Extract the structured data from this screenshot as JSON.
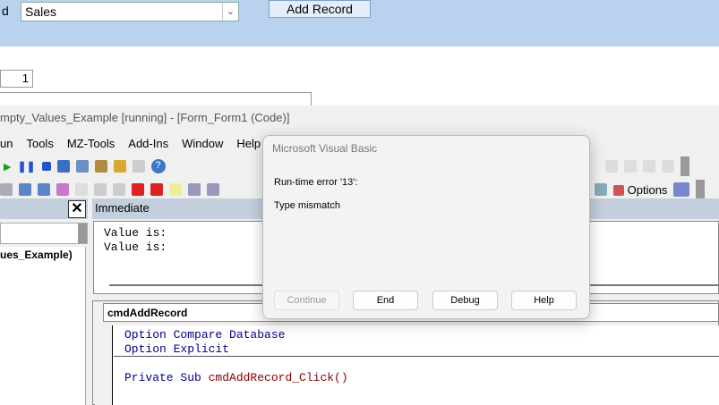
{
  "form": {
    "label_fragment": "d",
    "combo_value": "Sales",
    "add_button": "Add Record",
    "number_value": "1"
  },
  "vbe": {
    "title": "mpty_Values_Example [running] - [Form_Form1 (Code)]",
    "menu": [
      "un",
      "Tools",
      "MZ-Tools",
      "Add-Ins",
      "Window",
      "Help"
    ],
    "toolbar_options": "Options",
    "project_item": "ues_Example)",
    "immediate_title": "Immediate",
    "immediate_lines": [
      "Value is:",
      "Value is:"
    ],
    "object_combo": "cmdAddRecord",
    "code": {
      "l1a": "Option Compare Database",
      "l2a": "Option Explicit",
      "l3kw": "Private Sub ",
      "l3id": "cmdAddRecord_Click()"
    }
  },
  "dialog": {
    "title": "Microsoft Visual Basic",
    "error": "Run-time error '13':",
    "message": "Type mismatch",
    "buttons": {
      "continue": "Continue",
      "end": "End",
      "debug": "Debug",
      "help": "Help"
    }
  }
}
